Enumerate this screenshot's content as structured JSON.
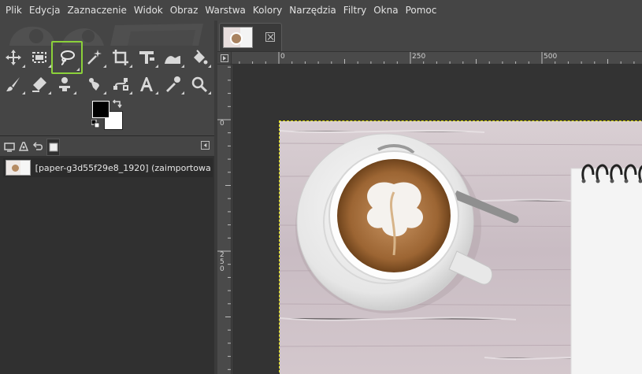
{
  "menubar": {
    "items": [
      "Plik",
      "Edycja",
      "Zaznaczenie",
      "Widok",
      "Obraz",
      "Warstwa",
      "Kolory",
      "Narzędzia",
      "Filtry",
      "Okna",
      "Pomoc"
    ]
  },
  "toolbox": {
    "tools_row1": [
      "move-tool-icon",
      "rect-select-tool-icon",
      "free-select-tool-icon",
      "fuzzy-select-tool-icon",
      "crop-tool-icon",
      "unified-transform-tool-icon",
      "warp-transform-tool-icon",
      "bucket-fill-tool-icon"
    ],
    "tools_row2": [
      "paintbrush-tool-icon",
      "eraser-tool-icon",
      "smudge-tool-icon",
      "clone-tool-icon",
      "paths-tool-icon",
      "text-tool-icon",
      "color-picker-tool-icon",
      "zoom-tool-icon"
    ],
    "active_tool": "free-select-tool-icon",
    "active_color": "#8bd13a",
    "foreground_color": "#000000",
    "background_color": "#ffffff"
  },
  "dock": {
    "tabs": [
      "tool-options-icon",
      "device-status-icon",
      "undo-history-icon",
      "layers-icon"
    ],
    "layer": {
      "name": "[paper-g3d55f29e8_1920] (zaimportowa"
    }
  },
  "image_tab": {
    "close_icon": "close-icon"
  },
  "rulers": {
    "h_labels": [
      "0",
      "250",
      "500"
    ],
    "v_labels": [
      "0",
      "2",
      "5",
      "0"
    ]
  },
  "colors": {
    "ui_bg": "#454545",
    "canvas_bg": "#333333",
    "selection_border": "#e6e600"
  }
}
